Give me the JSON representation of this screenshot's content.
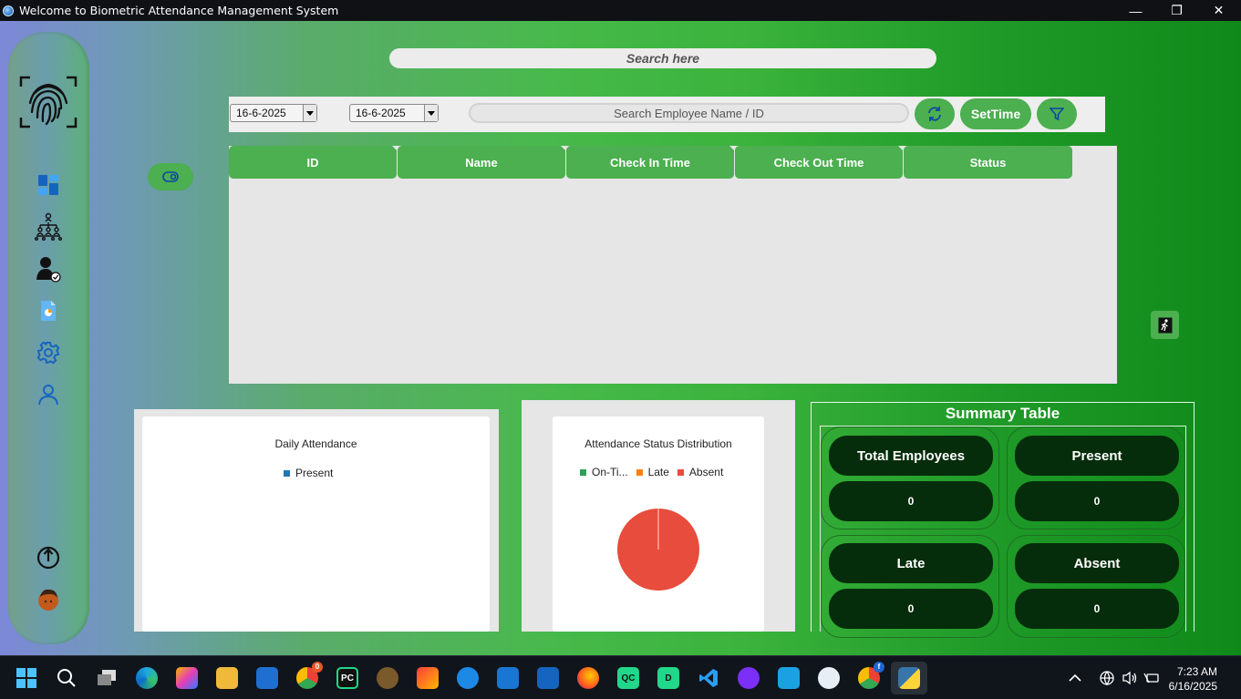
{
  "window": {
    "title": "Welcome to Biometric Attendance Management System",
    "minimize_glyph": "—",
    "maximize_glyph": "❐",
    "close_glyph": "✕"
  },
  "sidebar": {
    "icons": [
      "fingerprint-logo",
      "dashboard-icon",
      "org-chart-icon",
      "user-check-icon",
      "report-icon",
      "settings-icon",
      "profile-icon",
      "power-icon",
      "avatar"
    ]
  },
  "top_search": {
    "placeholder": "Search here"
  },
  "toolbar": {
    "date_from": "16-6-2025",
    "date_to": "16-6-2025",
    "employee_search_placeholder": "Search Employee Name / ID",
    "set_time_label": "SetTime"
  },
  "table": {
    "columns": [
      "ID",
      "Name",
      "Check In Time",
      "Check Out Time",
      "Status"
    ],
    "rows": []
  },
  "charts": {
    "daily": {
      "title": "Daily Attendance",
      "legend": [
        {
          "label": "Present",
          "color": "#1f77b4"
        }
      ]
    },
    "distribution": {
      "title": "Attendance Status Distribution",
      "legend": [
        {
          "label": "On-Ti...",
          "color": "#2ca05a"
        },
        {
          "label": "Late",
          "color": "#ff7f0e"
        },
        {
          "label": "Absent",
          "color": "#e74c3c"
        }
      ]
    }
  },
  "chart_data": [
    {
      "type": "bar",
      "title": "Daily Attendance",
      "series": [
        {
          "name": "Present",
          "values": []
        }
      ],
      "categories": []
    },
    {
      "type": "pie",
      "title": "Attendance Status Distribution",
      "labels": [
        "On-Ti...",
        "Late",
        "Absent"
      ],
      "values": [
        0,
        0,
        100
      ],
      "colors": [
        "#2ca05a",
        "#ff7f0e",
        "#e74c3c"
      ]
    }
  ],
  "summary": {
    "title": "Summary Table",
    "cards": [
      {
        "label": "Total Employees",
        "value": "0"
      },
      {
        "label": "Present",
        "value": "0"
      },
      {
        "label": "Late",
        "value": "0"
      },
      {
        "label": "Absent",
        "value": "0"
      }
    ]
  },
  "taskbar": {
    "time": "7:23 AM",
    "date": "6/16/2025",
    "chrome_badge": "0",
    "chrome2_badge": "f",
    "pycharm_label": "PC",
    "qc_label": "QC",
    "d_label": "D"
  },
  "colors": {
    "accent_green": "#4caf50",
    "dark_green": "#062d0b",
    "icon_blue": "#1565c0"
  }
}
